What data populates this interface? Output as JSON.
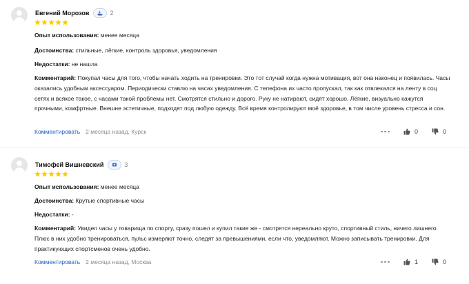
{
  "labels": {
    "experience": "Опыт использования:",
    "pros": "Достоинства:",
    "cons": "Недостатки:",
    "comment": "Комментарий:",
    "comment_link": "Комментировать"
  },
  "reviews": [
    {
      "author": "Евгений Морозов",
      "badge_count": "2",
      "rating": 5,
      "experience": "менее месяца",
      "pros": "стильные, лёгкие, контроль здоровья, уведомления",
      "cons": "не нашла",
      "comment": "Покупал часы для того, чтобы начать ходить на тренировки. Это тот случай когда нужна мотивация, вот она наконец и появилась. Часы оказались удобным аксессуаром. Периодически ставлю на часах уведомления. С телефона их часто пропускал, так как отвлекался на ленту в соц сетях и всякое такое, с часами такой проблемы нет. Смотрятся стильно и дорого. Руку не натирают, сидят хорошо. Лёгкие, визуально кажутся прочными, комфртные. Внешне эстетичные, подходят под любую одежду. Всё время контролируют моё здоровье, в том числе уровень стресса и сон.",
      "meta": "2 месяца назад, Курск",
      "likes": "0",
      "dislikes": "0"
    },
    {
      "author": "Тимофей Вишневский",
      "badge_count": "3",
      "rating": 5,
      "experience": "менее месяца",
      "pros": "Крутые спортивные часы",
      "cons": "-",
      "comment": "Увидел часы у товарища по спорту, сразу пошел и купил такие же - смотрятся нереально круто, спортивный стиль, ничего лишнего. Плюс в них удобно тренироваться, пульс измеряют точно, следят за превышениями, если что, уведомляют. Можно записывать тренировки. Для практикующих спортсменов очень удобно.",
      "meta": "2 месяца назад, Москва",
      "likes": "1",
      "dislikes": "0"
    }
  ],
  "colors": {
    "star": "#fc0",
    "link": "#1d5fbd",
    "meta": "#8a8a8a"
  },
  "icons": [
    "user-avatar-icon",
    "ship-badge-icon",
    "star-icon",
    "more-icon",
    "thumb-up-icon",
    "thumb-down-icon"
  ]
}
